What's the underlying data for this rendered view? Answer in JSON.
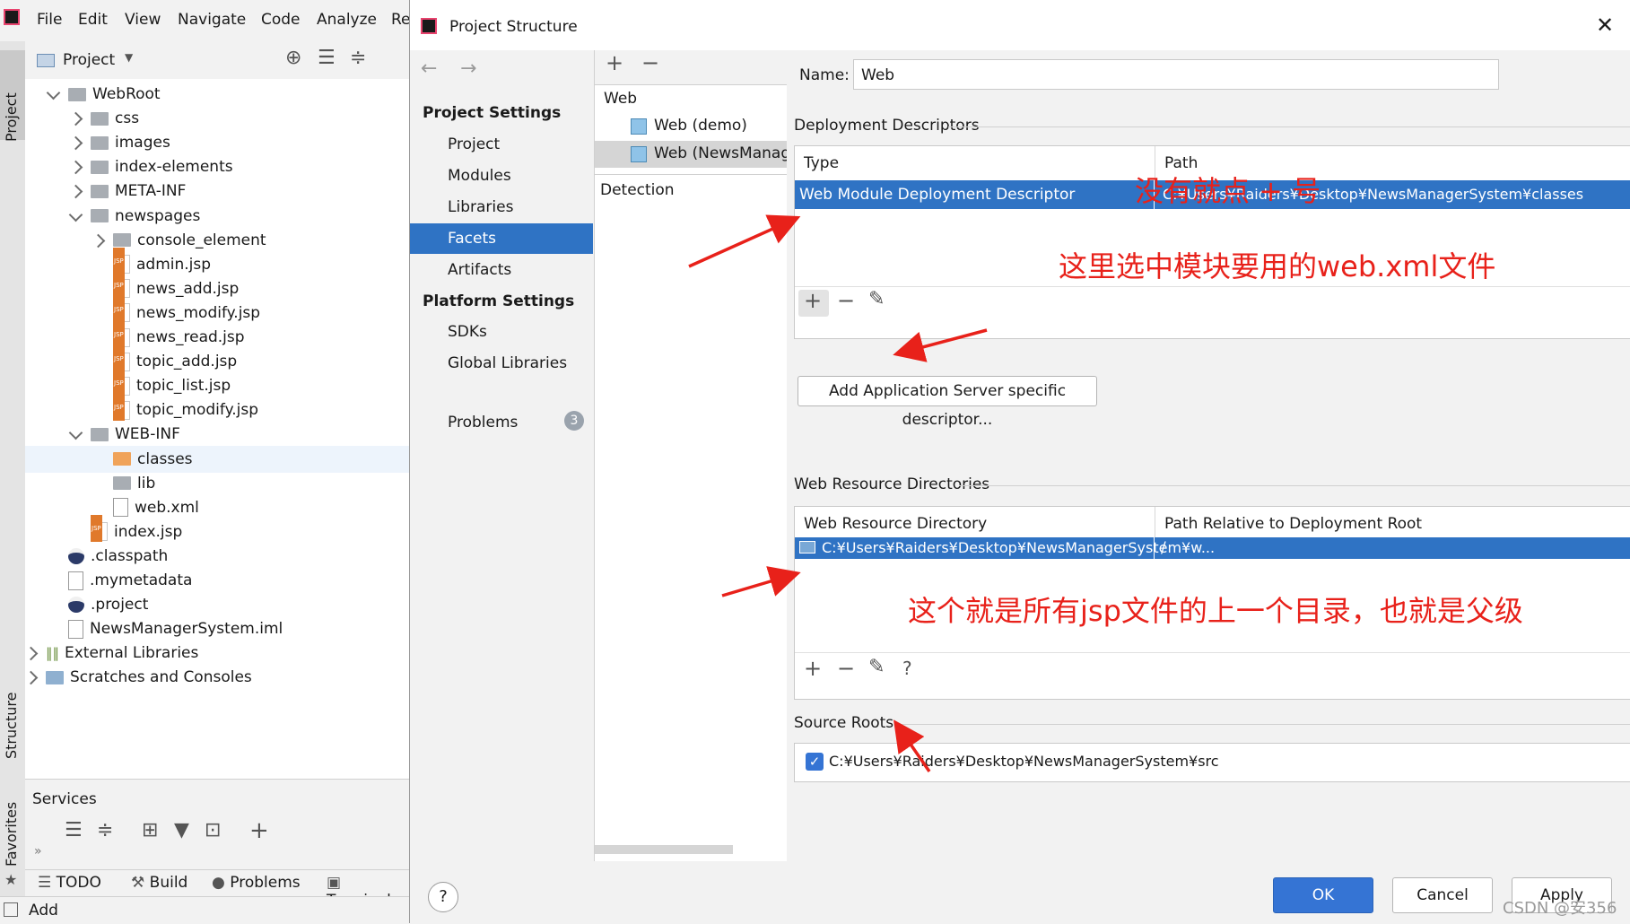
{
  "menu": {
    "items": [
      "File",
      "Edit",
      "View",
      "Navigate",
      "Code",
      "Analyze",
      "Re"
    ]
  },
  "sidebar": {
    "project_tab": "Project",
    "structure_tab": "Structure",
    "favorites_tab": "Favorites"
  },
  "project_panel": {
    "title": "Project",
    "tree": [
      {
        "label": "WebRoot",
        "icon": "folder-icon",
        "state": "expanded"
      },
      {
        "label": "css",
        "icon": "folder-icon",
        "state": "collapsed"
      },
      {
        "label": "images",
        "icon": "folder-icon",
        "state": "collapsed"
      },
      {
        "label": "index-elements",
        "icon": "folder-icon",
        "state": "collapsed"
      },
      {
        "label": "META-INF",
        "icon": "folder-icon",
        "state": "collapsed"
      },
      {
        "label": "newspages",
        "icon": "folder-icon",
        "state": "expanded"
      },
      {
        "label": "console_element",
        "icon": "folder-icon",
        "state": "collapsed"
      },
      {
        "label": "admin.jsp",
        "icon": "jsp-file-icon"
      },
      {
        "label": "news_add.jsp",
        "icon": "jsp-file-icon"
      },
      {
        "label": "news_modify.jsp",
        "icon": "jsp-file-icon"
      },
      {
        "label": "news_read.jsp",
        "icon": "jsp-file-icon"
      },
      {
        "label": "topic_add.jsp",
        "icon": "jsp-file-icon"
      },
      {
        "label": "topic_list.jsp",
        "icon": "jsp-file-icon"
      },
      {
        "label": "topic_modify.jsp",
        "icon": "jsp-file-icon"
      },
      {
        "label": "WEB-INF",
        "icon": "folder-icon",
        "state": "expanded"
      },
      {
        "label": "classes",
        "icon": "folder-orange-icon",
        "selected": true
      },
      {
        "label": "lib",
        "icon": "folder-icon"
      },
      {
        "label": "web.xml",
        "icon": "xml-file-icon"
      },
      {
        "label": "index.jsp",
        "icon": "jsp-file-icon"
      },
      {
        "label": ".classpath",
        "icon": "eclipse-icon"
      },
      {
        "label": ".mymetadata",
        "icon": "text-file-icon"
      },
      {
        "label": ".project",
        "icon": "eclipse-icon"
      },
      {
        "label": "NewsManagerSystem.iml",
        "icon": "module-file-icon"
      },
      {
        "label": "External Libraries",
        "icon": "library-icon",
        "state": "collapsed"
      },
      {
        "label": "Scratches and Consoles",
        "icon": "scratch-icon",
        "state": "collapsed"
      }
    ]
  },
  "services": {
    "title": "Services"
  },
  "bottom_tabs": [
    "TODO",
    "Build",
    "Problems",
    "Terminal"
  ],
  "status": {
    "text": "Add"
  },
  "dialog": {
    "title": "Project Structure",
    "nav": {
      "project_settings_header": "Project Settings",
      "project_settings": [
        "Project",
        "Modules",
        "Libraries",
        "Facets",
        "Artifacts"
      ],
      "platform_settings_header": "Platform Settings",
      "platform_settings": [
        "SDKs",
        "Global Libraries"
      ],
      "problems_label": "Problems",
      "problems_count": "3",
      "selected": "Facets"
    },
    "facets": {
      "group": "Web",
      "items": [
        "Web (demo)",
        "Web (NewsManag"
      ],
      "detection": "Detection"
    },
    "name_label": "Name:",
    "name_value": "Web",
    "deployment": {
      "header": "Deployment Descriptors",
      "col_type": "Type",
      "col_path": "Path",
      "row_type": "Web Module Deployment Descriptor",
      "row_path": "C:¥Users¥Raiders¥Desktop¥NewsManagerSystem¥classes",
      "add_server_button": "Add Application Server specific descriptor..."
    },
    "web_resources": {
      "header": "Web Resource Directories",
      "col_dir": "Web Resource Directory",
      "col_rel": "Path Relative to Deployment Root",
      "row_dir": "C:¥Users¥Raiders¥Desktop¥NewsManagerSystem¥w...",
      "row_rel": "/"
    },
    "source_roots": {
      "header": "Source Roots",
      "path": "C:¥Users¥Raiders¥Desktop¥NewsManagerSystem¥src",
      "checked": true
    },
    "buttons": {
      "ok": "OK",
      "cancel": "Cancel",
      "apply": "Apply",
      "help": "?"
    }
  },
  "annotations": {
    "add_hint": "没有就点 + 号",
    "select_xml": "这里选中模块要用的web.xml文件",
    "parent_dir": "这个就是所有jsp文件的上一个目录，也就是父级"
  },
  "watermark": "CSDN @安356",
  "colors": {
    "selection": "#2f73c4",
    "annotation": "#e8211a",
    "ok_button": "#3574d4"
  }
}
